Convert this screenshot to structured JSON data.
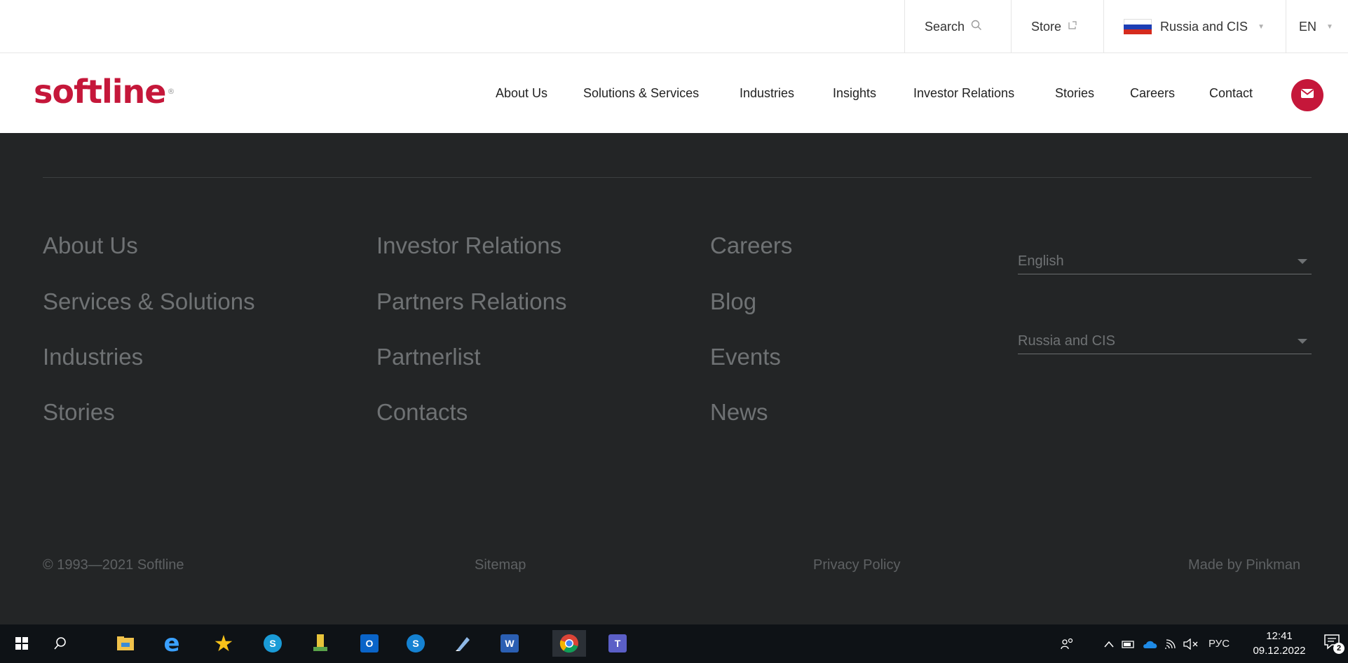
{
  "topbar": {
    "search_label": "Search",
    "store_label": "Store",
    "region_label": "Russia and CIS",
    "lang_label": "EN"
  },
  "brand": {
    "logo_text": "softline",
    "accent": "#c5173a"
  },
  "nav": {
    "items": [
      "About Us",
      "Solutions & Services",
      "Industries",
      "Insights",
      "Investor Relations",
      "Stories",
      "Careers",
      "Contact"
    ]
  },
  "footer": {
    "col1": [
      "About Us",
      "Services & Solutions",
      "Industries",
      "Stories"
    ],
    "col2": [
      "Investor Relations",
      "Partners Relations",
      "Partnerlist",
      "Contacts"
    ],
    "col3": [
      "Careers",
      "Blog",
      "Events",
      "News"
    ],
    "language_select": "English",
    "region_select": "Russia and CIS",
    "copyright": "© 1993—2021 Softline",
    "sitemap": "Sitemap",
    "privacy": "Privacy Policy",
    "made_by": "Made by Pinkman",
    "bg_color": "#232526"
  },
  "taskbar": {
    "input_lang": "РУС",
    "time": "12:41",
    "date": "09.12.2022",
    "notification_count": "2"
  }
}
